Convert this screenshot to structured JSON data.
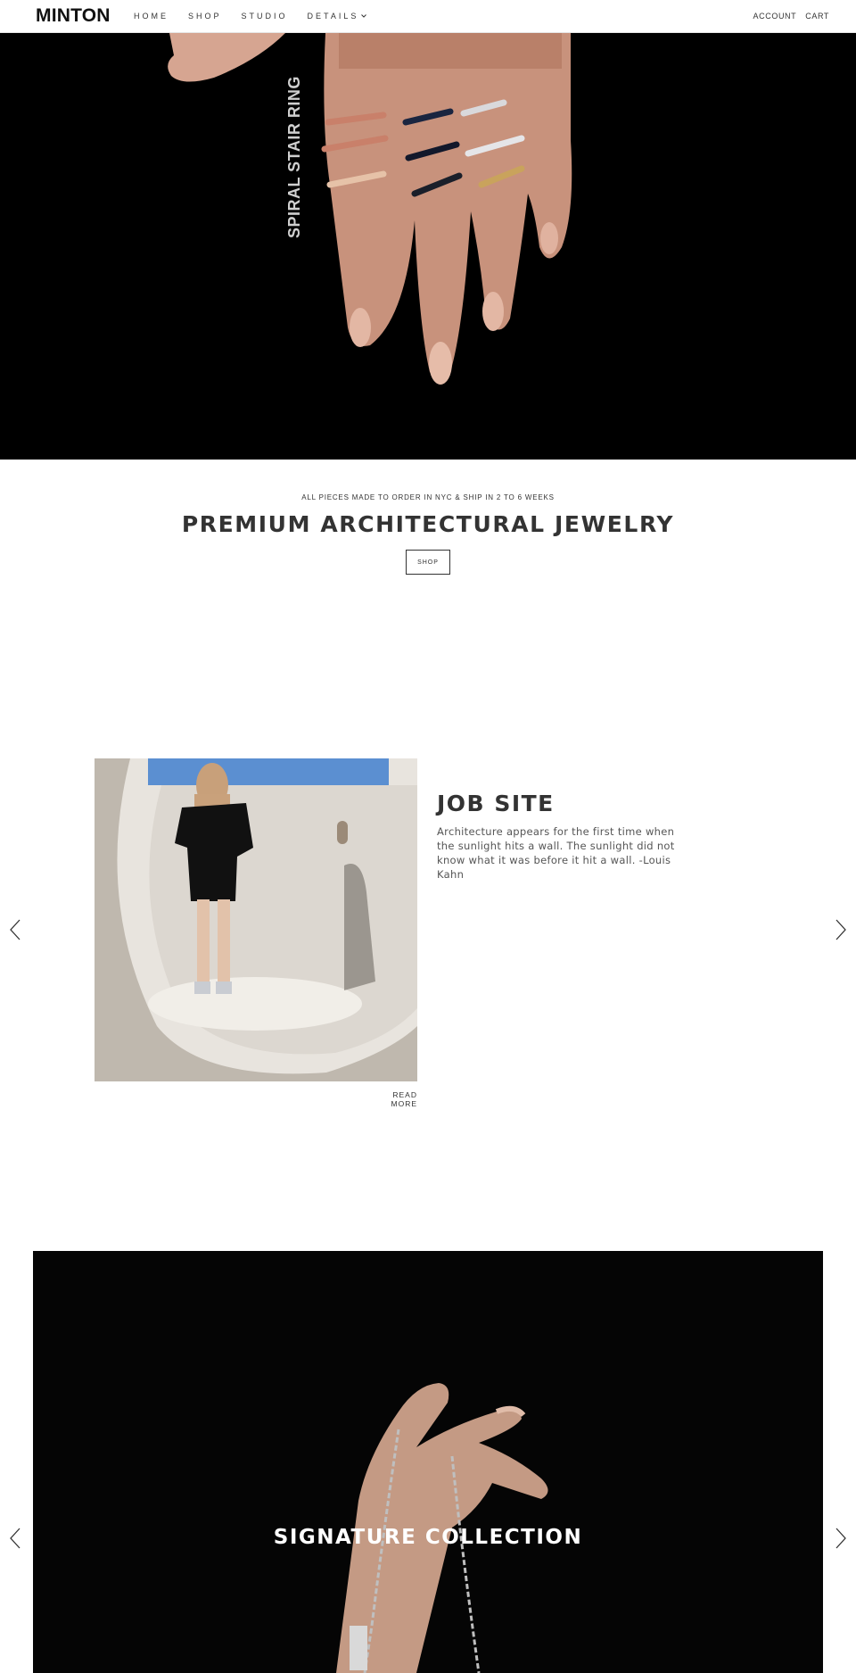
{
  "header": {
    "logo": "MINTON",
    "nav": [
      {
        "label": "HOME"
      },
      {
        "label": "SHOP"
      },
      {
        "label": "STUDIO"
      },
      {
        "label": "DETAILS",
        "has_dropdown": true
      }
    ],
    "account_label": "ACCOUNT",
    "cart_label": "CART"
  },
  "hero": {
    "image_text": "SPIRAL STAIR RING"
  },
  "intro": {
    "subtitle": "ALL PIECES MADE TO ORDER IN NYC & SHIP IN 2 TO 6 WEEKS",
    "title": "PREMIUM ARCHITECTURAL JEWELRY",
    "button_label": "SHOP"
  },
  "feature_slide": {
    "title": "JOB SITE",
    "body": "Architecture appears for the first time when the sunlight hits a wall. The sunlight did not know what it was before it hit a wall. -Louis Kahn",
    "link_label": "READ MORE"
  },
  "collection_slide": {
    "title": "SIGNATURE COLLECTION"
  },
  "colors": {
    "text": "#333333",
    "background": "#ffffff",
    "hero_bg": "#000000"
  }
}
